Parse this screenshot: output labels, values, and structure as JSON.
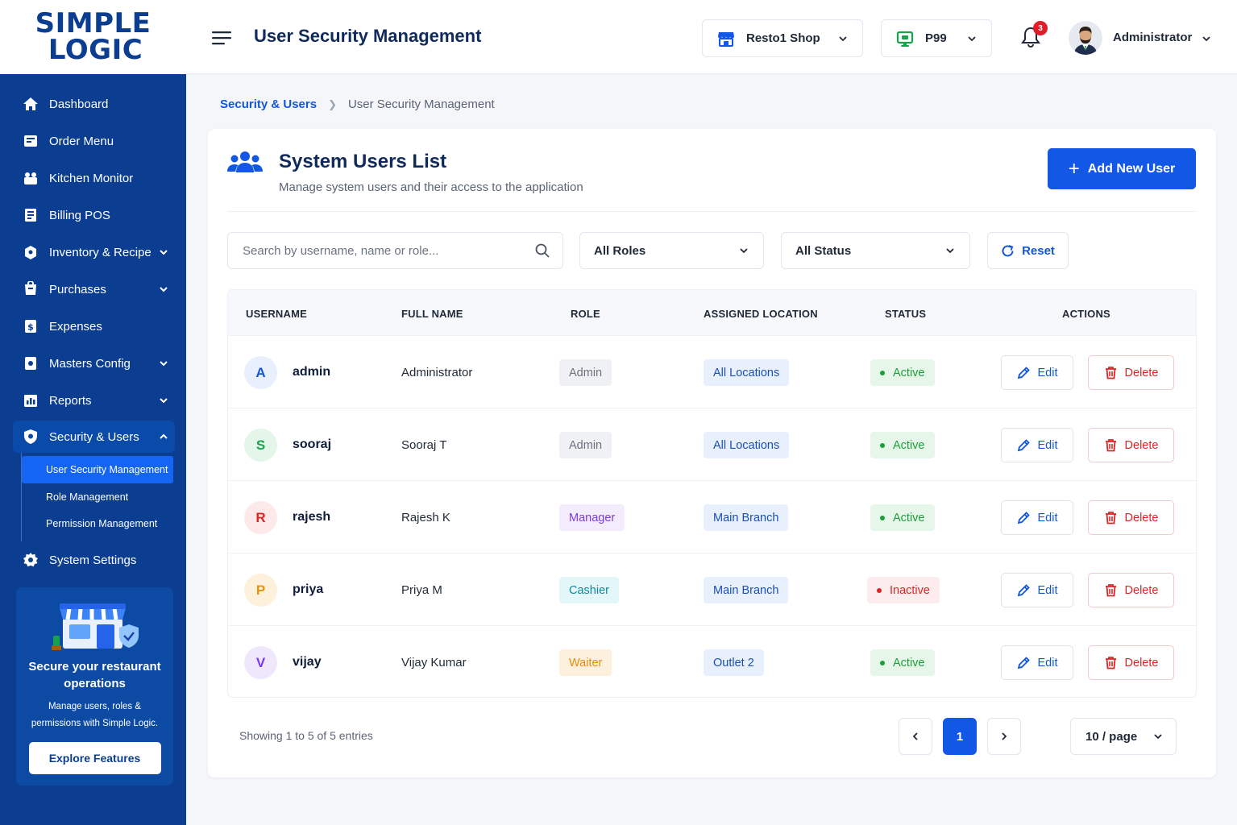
{
  "brand": {
    "line1": "SIMPLE",
    "line2": "LOGIC"
  },
  "sidebar": {
    "items": [
      {
        "label": "Dashboard",
        "icon": "home-icon"
      },
      {
        "label": "Order Menu",
        "icon": "order-menu-icon"
      },
      {
        "label": "Kitchen Monitor",
        "icon": "kitchen-monitor-icon"
      },
      {
        "label": "Billing POS",
        "icon": "billing-icon"
      },
      {
        "label": "Inventory & Recipe",
        "icon": "inventory-icon",
        "chevron": "down"
      },
      {
        "label": "Purchases",
        "icon": "purchases-icon",
        "chevron": "down"
      },
      {
        "label": "Expenses",
        "icon": "expenses-icon"
      },
      {
        "label": "Masters Config",
        "icon": "masters-config-icon",
        "chevron": "down"
      },
      {
        "label": "Reports",
        "icon": "reports-icon",
        "chevron": "down"
      },
      {
        "label": "Security & Users",
        "icon": "shield-icon",
        "chevron": "up"
      },
      {
        "label": "System Settings",
        "icon": "gear-icon"
      }
    ],
    "subitems": [
      {
        "label": "User Security Management",
        "active": true
      },
      {
        "label": "Role Management"
      },
      {
        "label": "Permission Management"
      }
    ],
    "promo": {
      "title": "Secure your restaurant operations",
      "text": "Manage users, roles & permissions with Simple Logic.",
      "button": "Explore Features"
    }
  },
  "header": {
    "title": "User Security Management",
    "shop": "Resto1 Shop",
    "terminal": "P99",
    "notifications": "3",
    "user": "Administrator"
  },
  "breadcrumb": {
    "parent": "Security & Users",
    "current": "User Security Management"
  },
  "card": {
    "title": "System Users List",
    "subtitle": "Manage system users and their access to the application",
    "add_button": "Add New User"
  },
  "filters": {
    "search_placeholder": "Search by username, name or role...",
    "role": "All Roles",
    "status": "All Status",
    "reset": "Reset"
  },
  "table": {
    "headers": [
      "USERNAME",
      "FULL NAME",
      "ROLE",
      "ASSIGNED LOCATION",
      "STATUS",
      "ACTIONS"
    ],
    "edit_label": "Edit",
    "delete_label": "Delete",
    "rows": [
      {
        "initial": "A",
        "username": "admin",
        "full_name": "Administrator",
        "role": "Admin",
        "location": "All Locations",
        "status": "Active"
      },
      {
        "initial": "S",
        "username": "sooraj",
        "full_name": "Sooraj T",
        "role": "Admin",
        "location": "All Locations",
        "status": "Active"
      },
      {
        "initial": "R",
        "username": "rajesh",
        "full_name": "Rajesh K",
        "role": "Manager",
        "location": "Main Branch",
        "status": "Active"
      },
      {
        "initial": "P",
        "username": "priya",
        "full_name": "Priya M",
        "role": "Cashier",
        "location": "Main Branch",
        "status": "Inactive"
      },
      {
        "initial": "V",
        "username": "vijay",
        "full_name": "Vijay Kumar",
        "role": "Waiter",
        "location": "Outlet 2",
        "status": "Active"
      }
    ]
  },
  "footer": {
    "showing": "Showing 1 to 5 of 5 entries",
    "current_page": "1",
    "per_page": "10 / page"
  },
  "colors": {
    "sidebar_bg": "#0b3d91",
    "primary": "#1257e6",
    "active_green": "#1f9d3b",
    "inactive_red": "#dc2626"
  }
}
